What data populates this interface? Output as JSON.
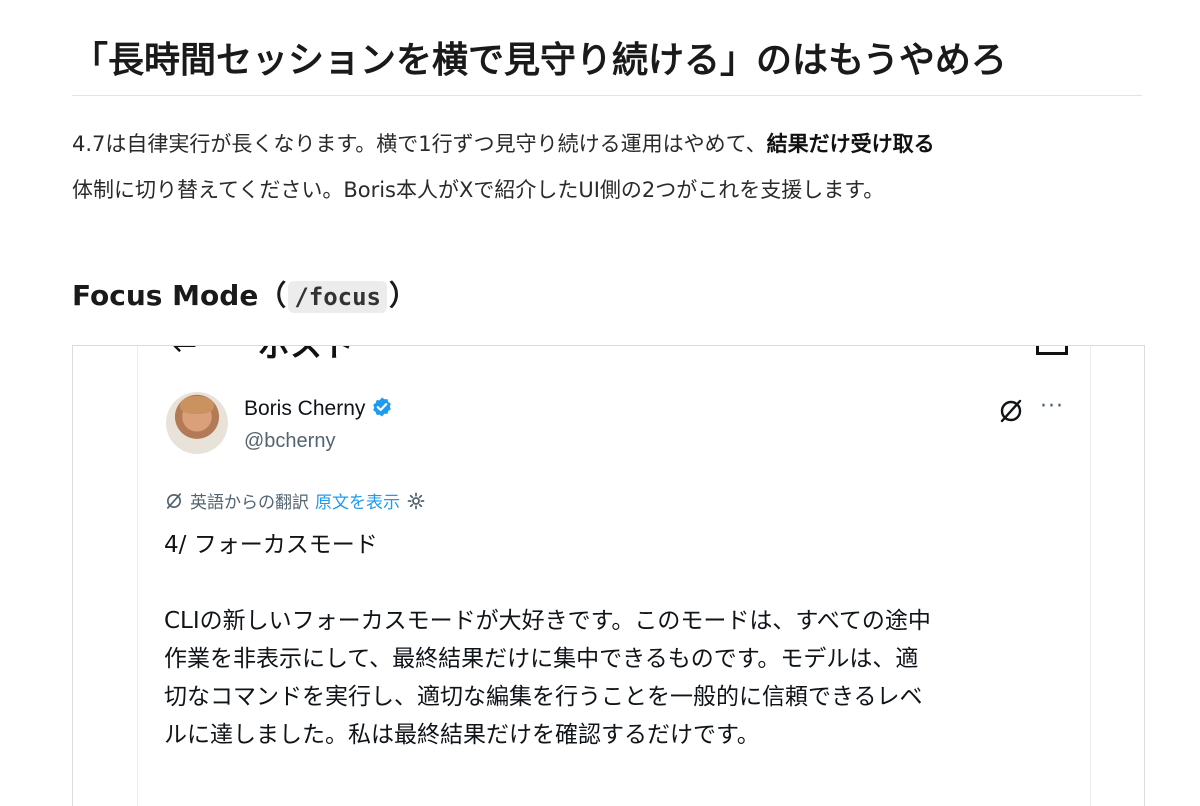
{
  "article": {
    "heading": "「長時間セッションを横で見守り続ける」のはもうやめろ",
    "paragraph": {
      "line1_pre": "4.7は自律実行が長くなります。横で1行ずつ見守り続ける運用はやめて、",
      "line1_bold": "結果だけ受け取る",
      "line2": "体制に切り替えてください。Boris本人がXで紹介したUI側の2つがこれを支援します。"
    },
    "subheading": {
      "text": "Focus Mode（",
      "code": "/focus",
      "close": "）"
    }
  },
  "embed": {
    "header_back": "←",
    "header_title": "ポスト",
    "author": {
      "name": "Boris Cherny",
      "handle": "@bcherny"
    },
    "translate": {
      "label": "英語からの翻訳",
      "show_original": "原文を表示"
    },
    "tweet": {
      "line1": "4/ フォーカスモード",
      "line2": "CLIの新しいフォーカスモードが大好きです。このモードは、すべての途中",
      "line3": "作業を非表示にして、最終結果だけに集中できるものです。モデルは、適",
      "line4": "切なコマンドを実行し、適切な編集を行うことを一般的に信頼できるレベ",
      "line5": "ルに達しました。私は最終結果だけを確認するだけです。"
    },
    "colors": {
      "link": "#1d9bf0",
      "secondary_text": "#536471",
      "verified": "#1d9bf0"
    }
  }
}
